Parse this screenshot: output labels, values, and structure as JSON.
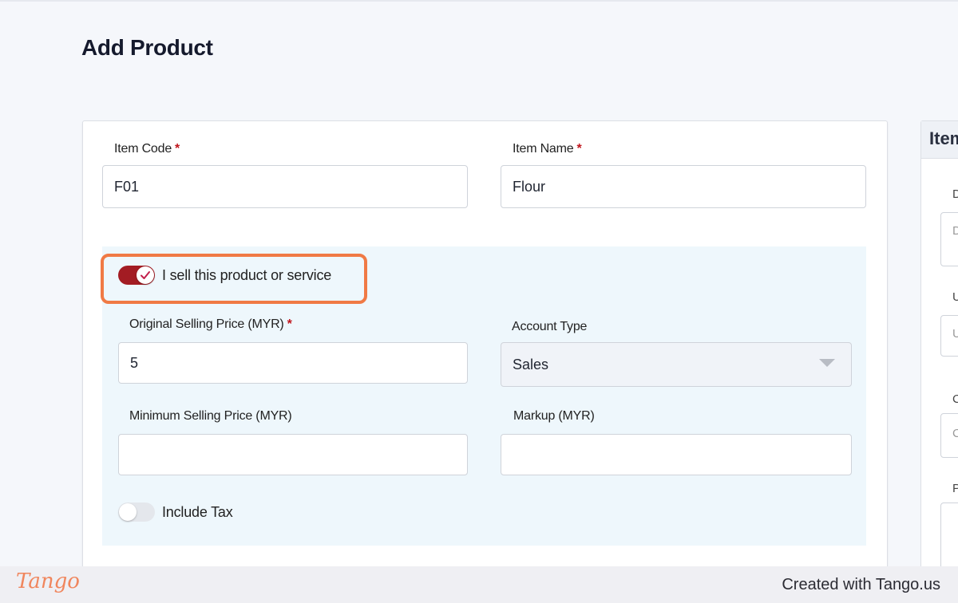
{
  "page": {
    "title": "Add Product"
  },
  "form": {
    "item_code": {
      "label": "Item Code",
      "value": "F01",
      "required_mark": "*"
    },
    "item_name": {
      "label": "Item Name",
      "value": "Flour",
      "required_mark": "*"
    },
    "sell_toggle": {
      "label": "I sell this product or service",
      "on": true
    },
    "original_selling_price": {
      "label": "Original Selling Price (MYR)",
      "value": "5",
      "required_mark": "*"
    },
    "account_type": {
      "label": "Account Type",
      "value": "Sales"
    },
    "minimum_selling_price": {
      "label": "Minimum Selling Price (MYR)",
      "value": ""
    },
    "markup": {
      "label": "Markup (MYR)",
      "value": ""
    },
    "include_tax": {
      "label": "Include Tax",
      "on": false
    }
  },
  "side_panel": {
    "title": "Item",
    "field_letters": [
      "D",
      "D",
      "U",
      "U",
      "C",
      "C",
      "P"
    ]
  },
  "footer": {
    "logo": "Tango",
    "created_with": "Created with Tango.us"
  },
  "colors": {
    "accent": "#a31c23",
    "highlight": "#f07a45",
    "panel_bg": "#eef7fc",
    "required": "#c0151c"
  }
}
